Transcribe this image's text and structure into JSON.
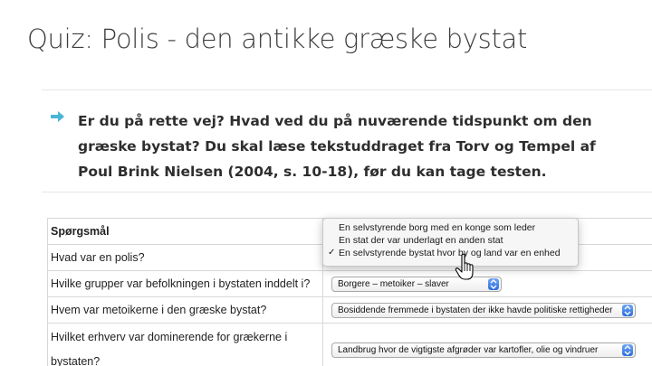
{
  "page": {
    "title": "Quiz: Polis - den antikke græske bystat",
    "intro": "Er du på rette vej? Hvad ved du på nuværende tidspunkt om den græske bystat? Du skal læse tekstuddraget fra Torv og Tempel af Poul Brink Nielsen (2004, s. 10-18), før du kan tage testen.",
    "arrow_icon": "arrow-right-icon",
    "accent_color": "#49b6d6"
  },
  "table": {
    "header": "Spørgsmål",
    "rows": [
      {
        "question": "Hvad var en polis?"
      },
      {
        "question": "Hvilke grupper var befolkningen i bystaten inddelt i?",
        "answer": "Borgere – metoiker – slaver"
      },
      {
        "question": "Hvem var metoikerne i den græske bystat?",
        "answer": "Bosiddende fremmede i bystaten der ikke havde politiske rettigheder"
      },
      {
        "question": "Hvilket erhverv var dominerende for grækerne i bystaten?",
        "answer": "Landbrug hvor de vigtigste afgrøder var kartofler, olie og vindruer"
      }
    ]
  },
  "dropdown": {
    "options": [
      "En selvstyrende borg med en konge som leder",
      "En stat der var underlagt en anden stat",
      "En selvstyrende bystat hvor by og land var en enhed"
    ],
    "check_mark": "✓"
  }
}
